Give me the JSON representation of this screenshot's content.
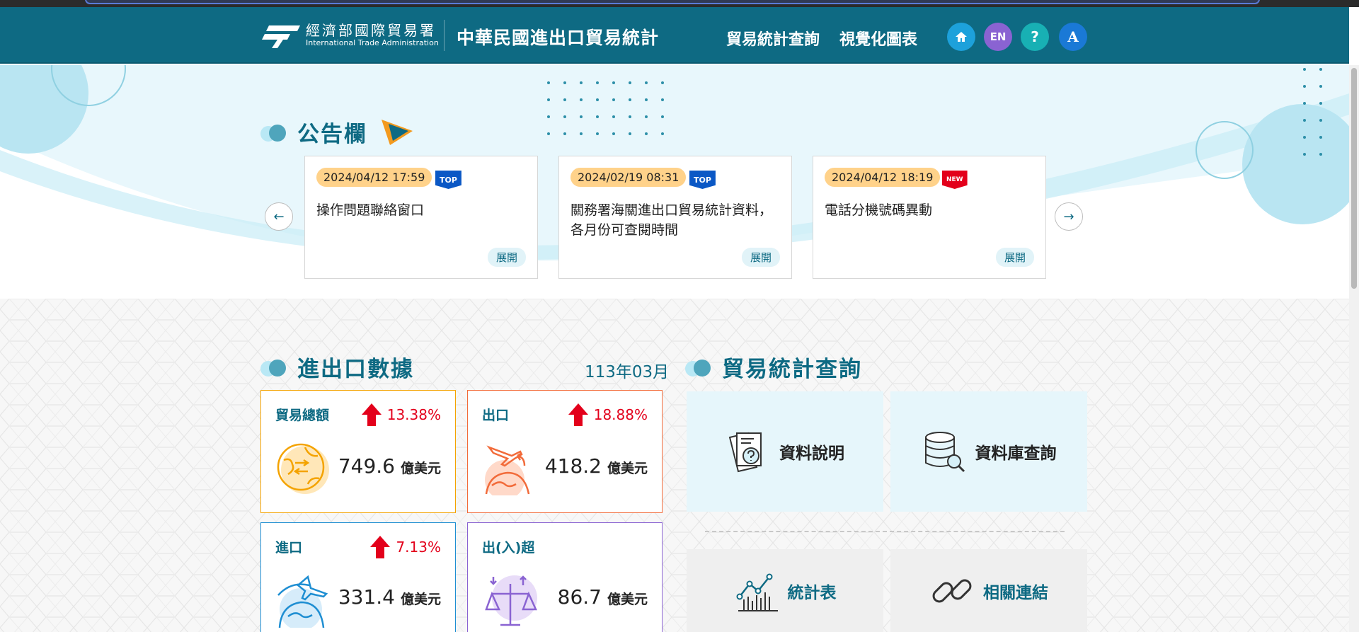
{
  "header": {
    "org_name_cn": "經濟部國際貿易署",
    "org_name_en": "International Trade Administration",
    "site_title": "中華民國進出口貿易統計",
    "nav": [
      "貿易統計查詢",
      "視覺化圖表"
    ],
    "buttons": {
      "home": "home-icon",
      "en_label": "EN",
      "help_label": "?",
      "font_label": "A"
    },
    "colors": {
      "primary": "#0e6a83",
      "home": "#1da1db",
      "en": "#8a63d2",
      "help": "#18b0b4",
      "font": "#1a79d6"
    }
  },
  "announcements": {
    "title": "公告欄",
    "items": [
      {
        "date": "2024/04/12 17:59",
        "badge": "TOP",
        "title": "操作問題聯絡窗口",
        "expand": "展開"
      },
      {
        "date": "2024/02/19 08:31",
        "badge": "TOP",
        "title": "關務署海關進出口貿易統計資料，各月份可查閱時間",
        "expand": "展開"
      },
      {
        "date": "2024/04/12 18:19",
        "badge": "NEW",
        "title": "電話分機號碼異動",
        "expand": "展開"
      }
    ],
    "prev": "←",
    "next": "→"
  },
  "trade_data": {
    "title": "進出口數據",
    "period": "113年03月",
    "cards": [
      {
        "label": "貿易總額",
        "pct": "13.38%",
        "value": "749.6",
        "unit": "億美元",
        "color": "#f4a300",
        "label_color": "#0e6a83"
      },
      {
        "label": "出口",
        "pct": "18.88%",
        "value": "418.2",
        "unit": "億美元",
        "color": "#f26b3a",
        "label_color": "#0e6a83"
      },
      {
        "label": "進口",
        "pct": "7.13%",
        "value": "331.4",
        "unit": "億美元",
        "color": "#1e8ed2",
        "label_color": "#0e6a83"
      },
      {
        "label": "出(入)超",
        "pct": "",
        "value": "86.7",
        "unit": "億美元",
        "color": "#8a63d2",
        "label_color": "#0e6a83"
      }
    ]
  },
  "query": {
    "title": "貿易統計查詢",
    "items": [
      "資料說明",
      "資料庫查詢",
      "統計表",
      "相關連結"
    ]
  }
}
